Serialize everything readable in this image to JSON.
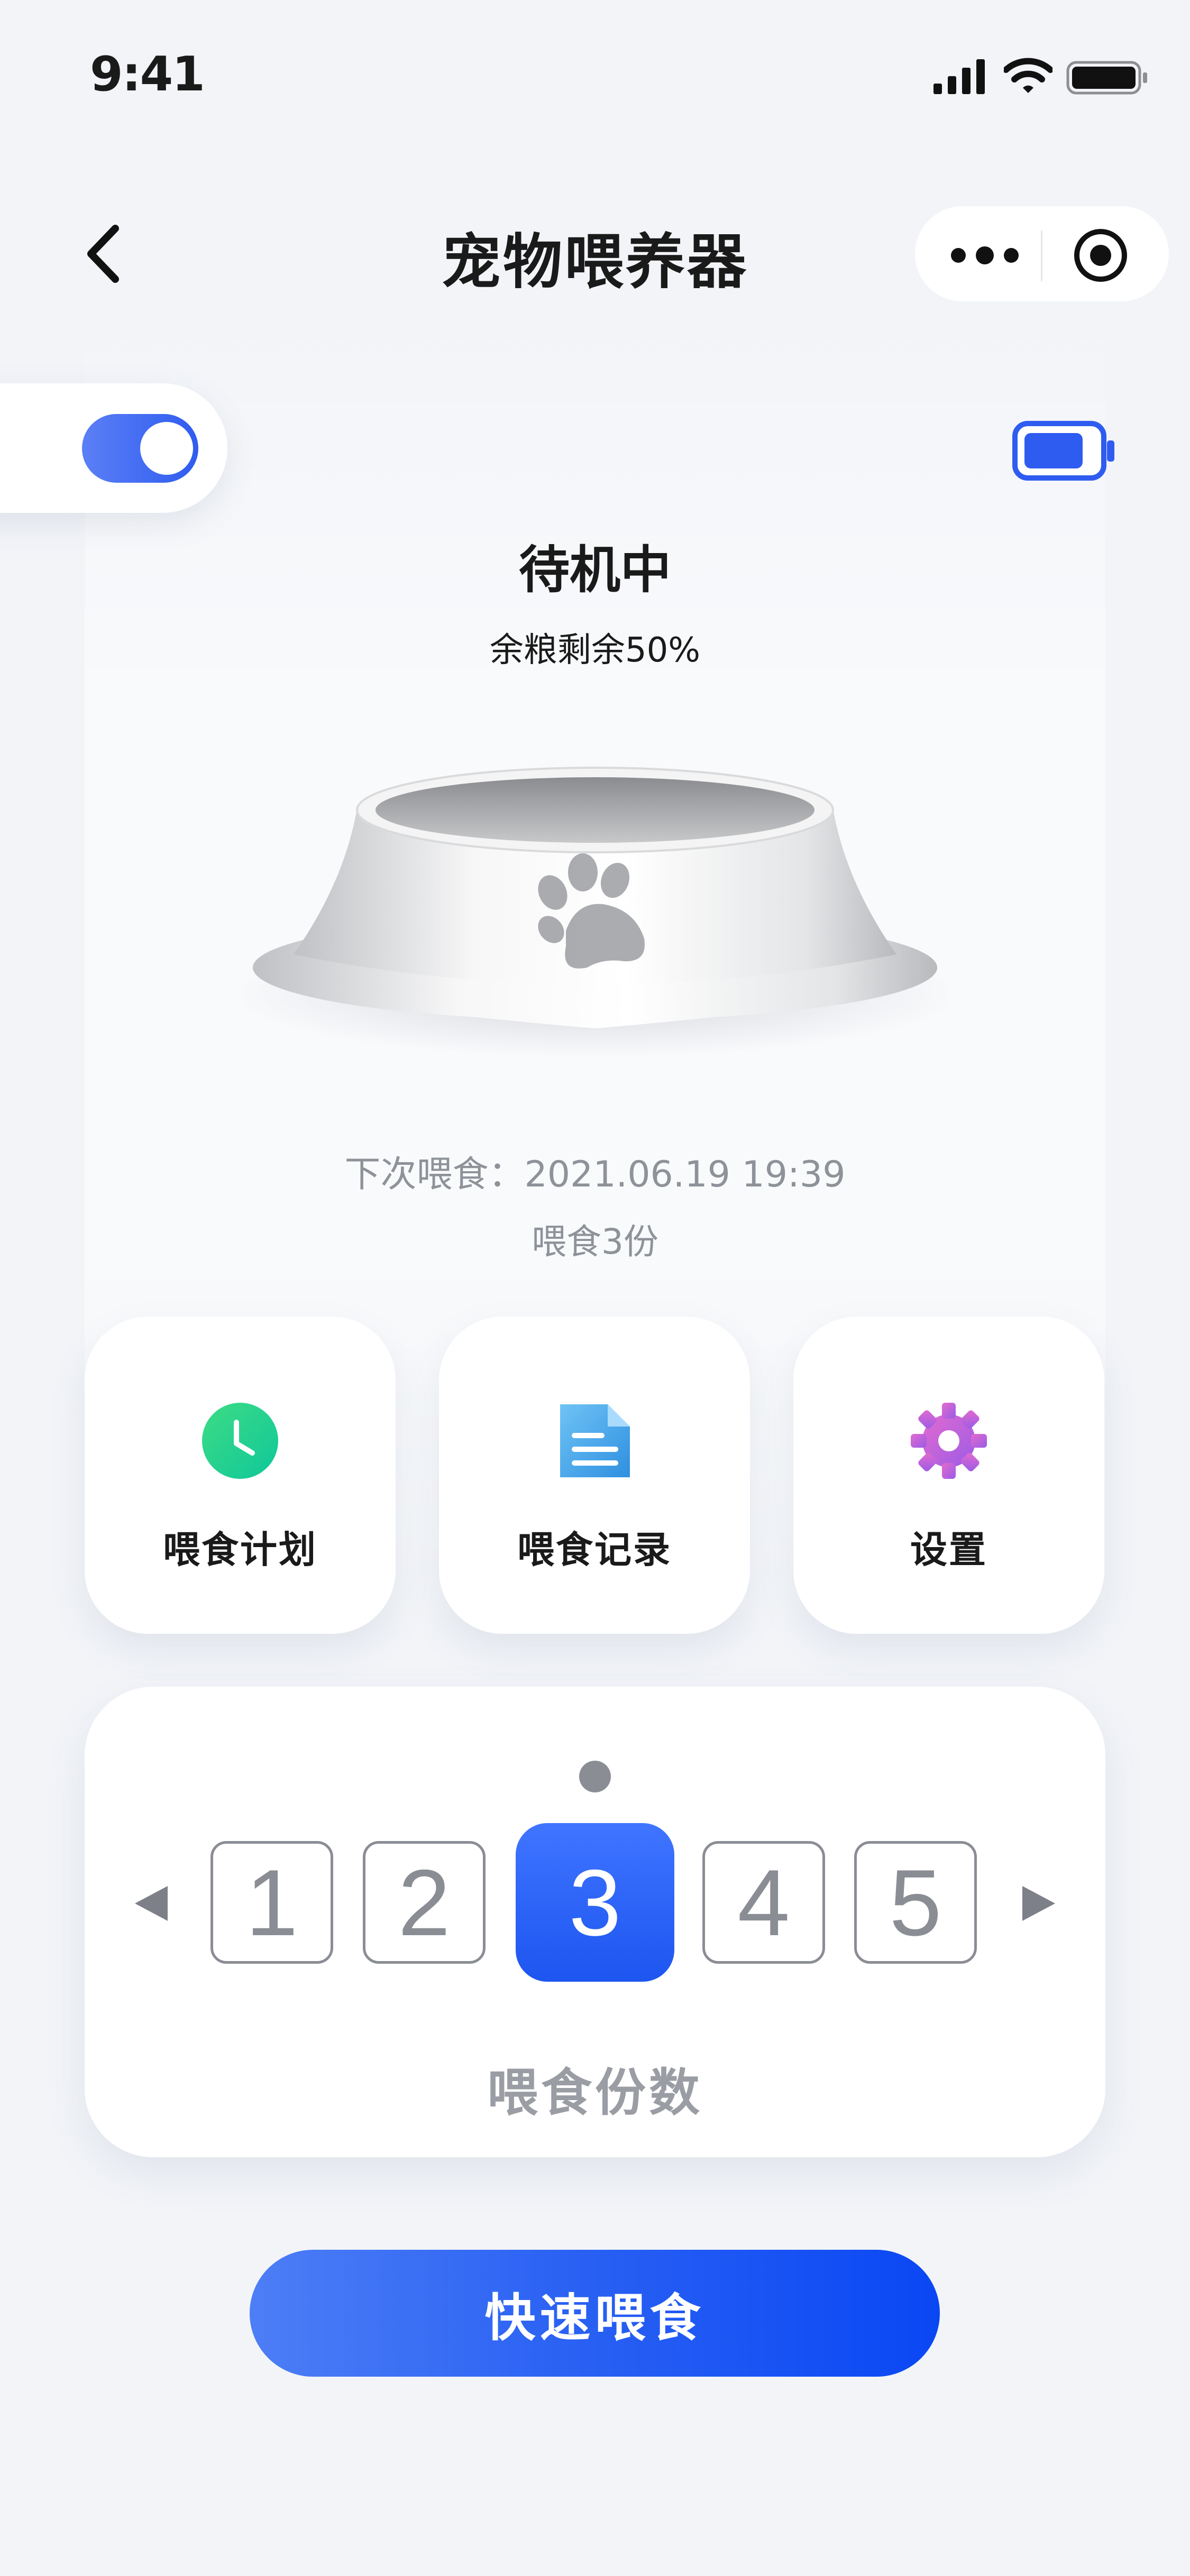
{
  "status_bar": {
    "time": "9:41"
  },
  "nav": {
    "title": "宠物喂养器"
  },
  "device": {
    "power_on": true,
    "status": "待机中",
    "food_remaining": "余粮剩余50%"
  },
  "schedule": {
    "next_feed": "下次喂食：2021.06.19 19:39",
    "amount": "喂食3份"
  },
  "actions": [
    {
      "label": "喂食计划",
      "icon": "clock-icon"
    },
    {
      "label": "喂食记录",
      "icon": "document-icon"
    },
    {
      "label": "设置",
      "icon": "gear-icon"
    }
  ],
  "portions": {
    "options": [
      "1",
      "2",
      "3",
      "4",
      "5"
    ],
    "selected": "3",
    "label": "喂食份数"
  },
  "quick_feed": {
    "label": "快速喂食"
  },
  "colors": {
    "accent": "#2f5cf0",
    "gray": "#8a8d94",
    "background": "#f2f4f8"
  }
}
